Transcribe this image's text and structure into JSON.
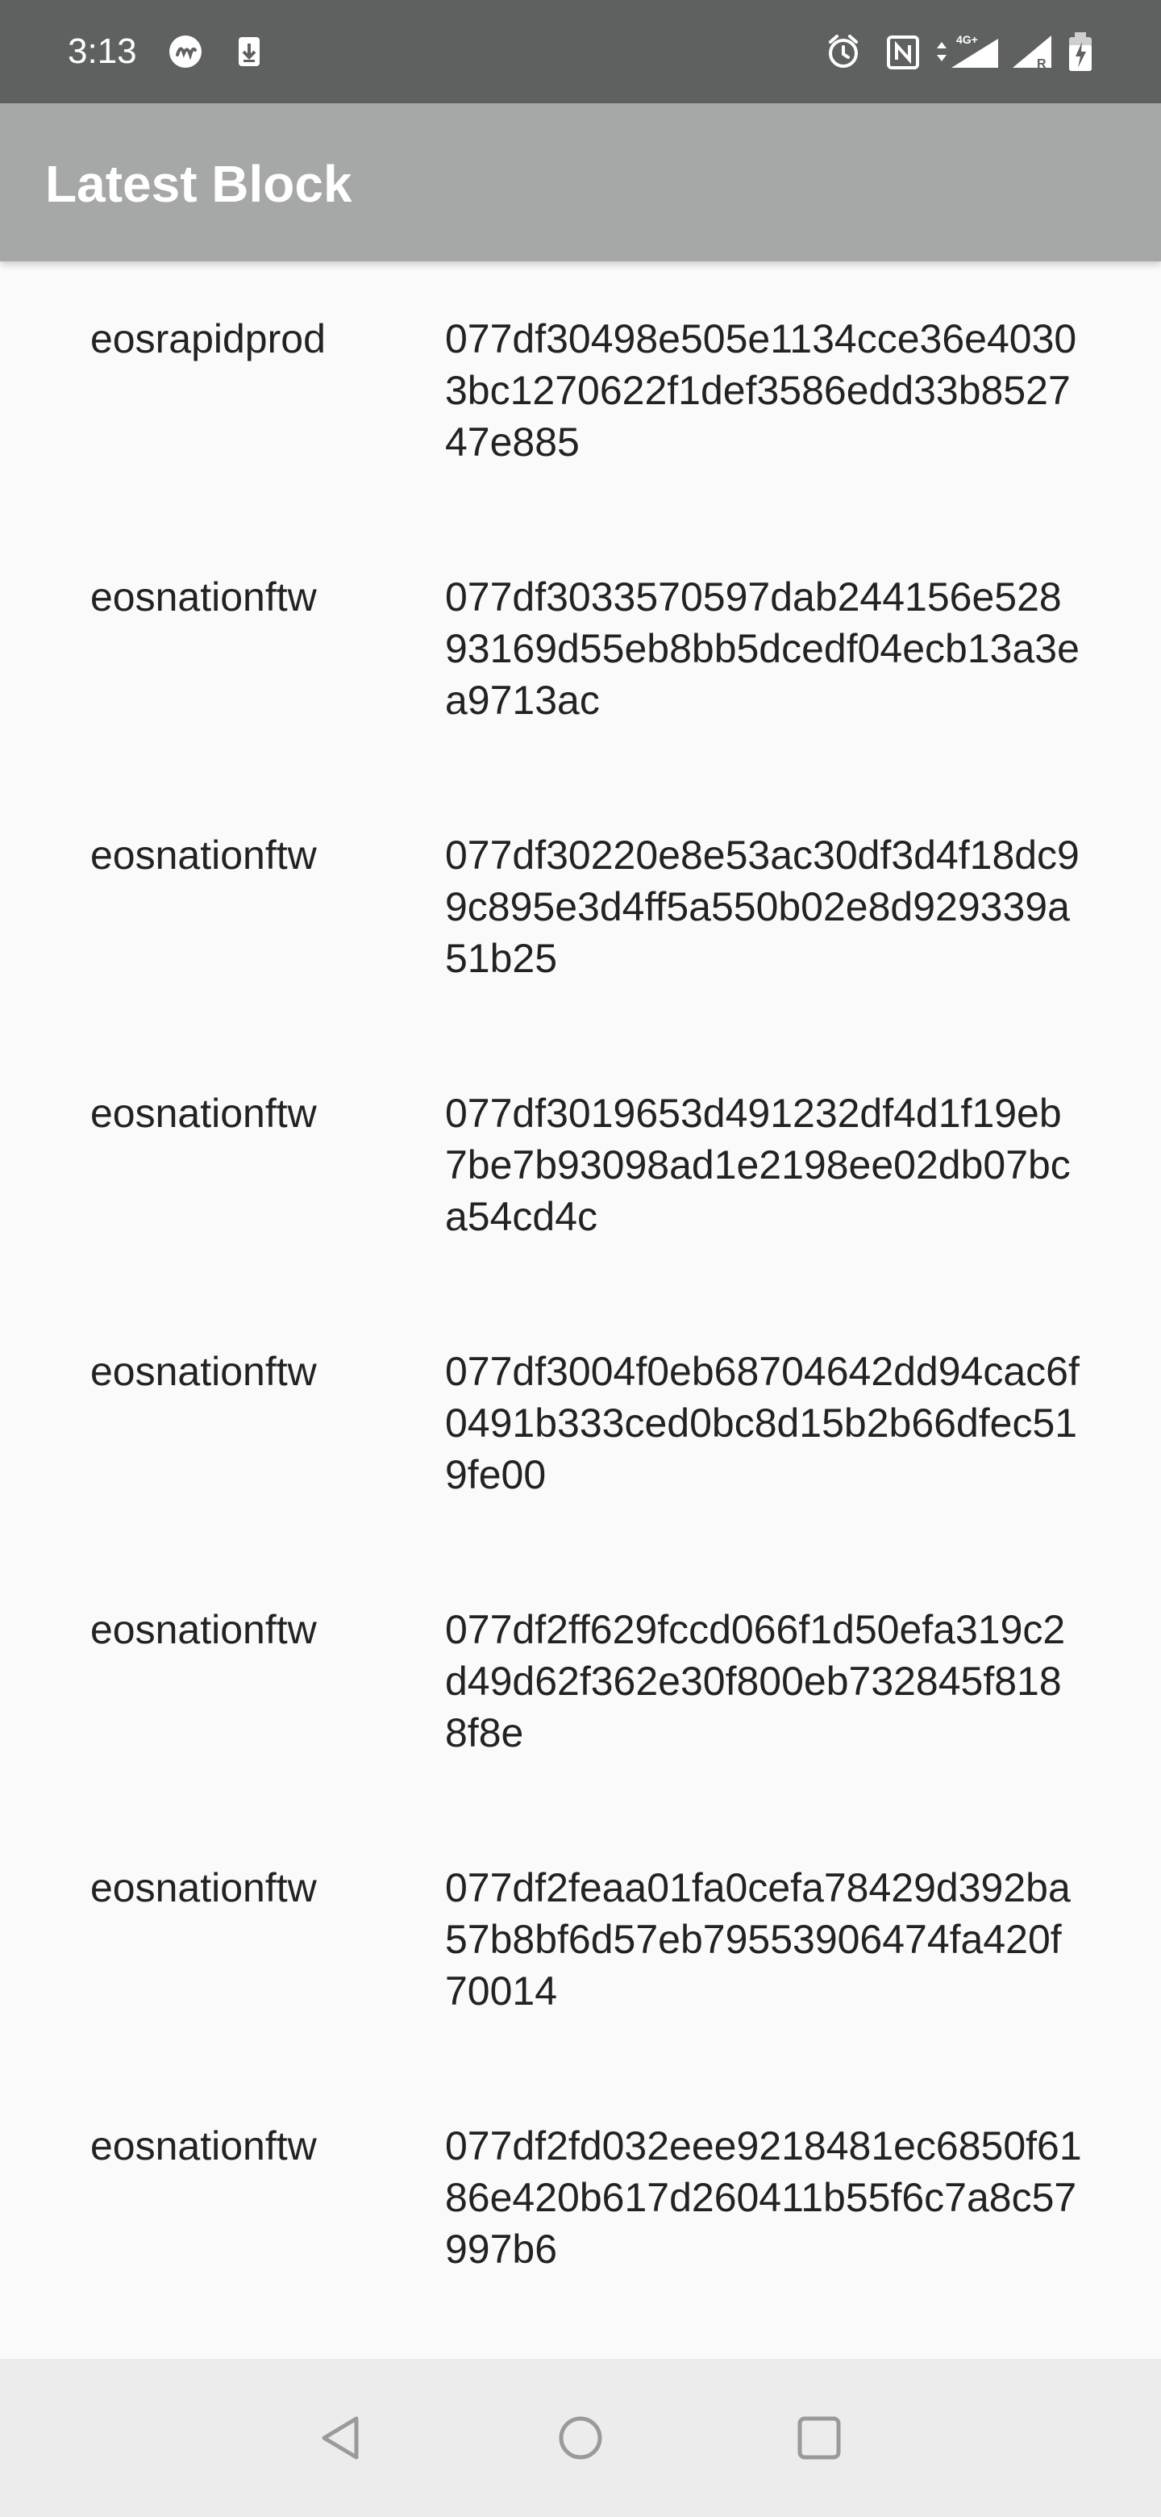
{
  "status_bar": {
    "time": "3:13",
    "icons": [
      "app-notification-icon",
      "download-icon",
      "alarm-icon",
      "nfc-icon",
      "signal-4g-icon",
      "signal-roaming-icon",
      "battery-charging-icon"
    ]
  },
  "app_bar": {
    "title": "Latest Block"
  },
  "blocks": [
    {
      "producer": "eosrapidprod",
      "id": "077df30498e505e1134cce36e40303bc1270622f1def3586edd33b852747e885"
    },
    {
      "producer": "eosnationftw",
      "id": "077df3033570597dab244156e52893169d55eb8bb5dcedf04ecb13a3ea9713ac"
    },
    {
      "producer": "eosnationftw",
      "id": "077df30220e8e53ac30df3d4f18dc99c895e3d4ff5a550b02e8d929339a51b25"
    },
    {
      "producer": "eosnationftw",
      "id": "077df3019653d491232df4d1f19eb7be7b93098ad1e2198ee02db07bca54cd4c"
    },
    {
      "producer": "eosnationftw",
      "id": "077df3004f0eb68704642dd94cac6f0491b333ced0bc8d15b2b66dfec519fe00"
    },
    {
      "producer": "eosnationftw",
      "id": "077df2ff629fccd066f1d50efa319c2d49d62f362e30f800eb732845f8188f8e"
    },
    {
      "producer": "eosnationftw",
      "id": "077df2feaa01fa0cefa78429d392ba57b8bf6d57eb79553906474fa420f70014"
    },
    {
      "producer": "eosnationftw",
      "id": "077df2fd032eee9218481ec6850f6186e420b617d260411b55f6c7a8c57997b6"
    }
  ],
  "nav_bar": {
    "buttons": [
      "back-icon",
      "home-icon",
      "recents-icon"
    ]
  },
  "colors": {
    "status_bar": "#5f6060",
    "app_bar": "#a5a8a7",
    "background": "#fafafa",
    "nav_bar": "#ececec",
    "text": "#222222"
  }
}
